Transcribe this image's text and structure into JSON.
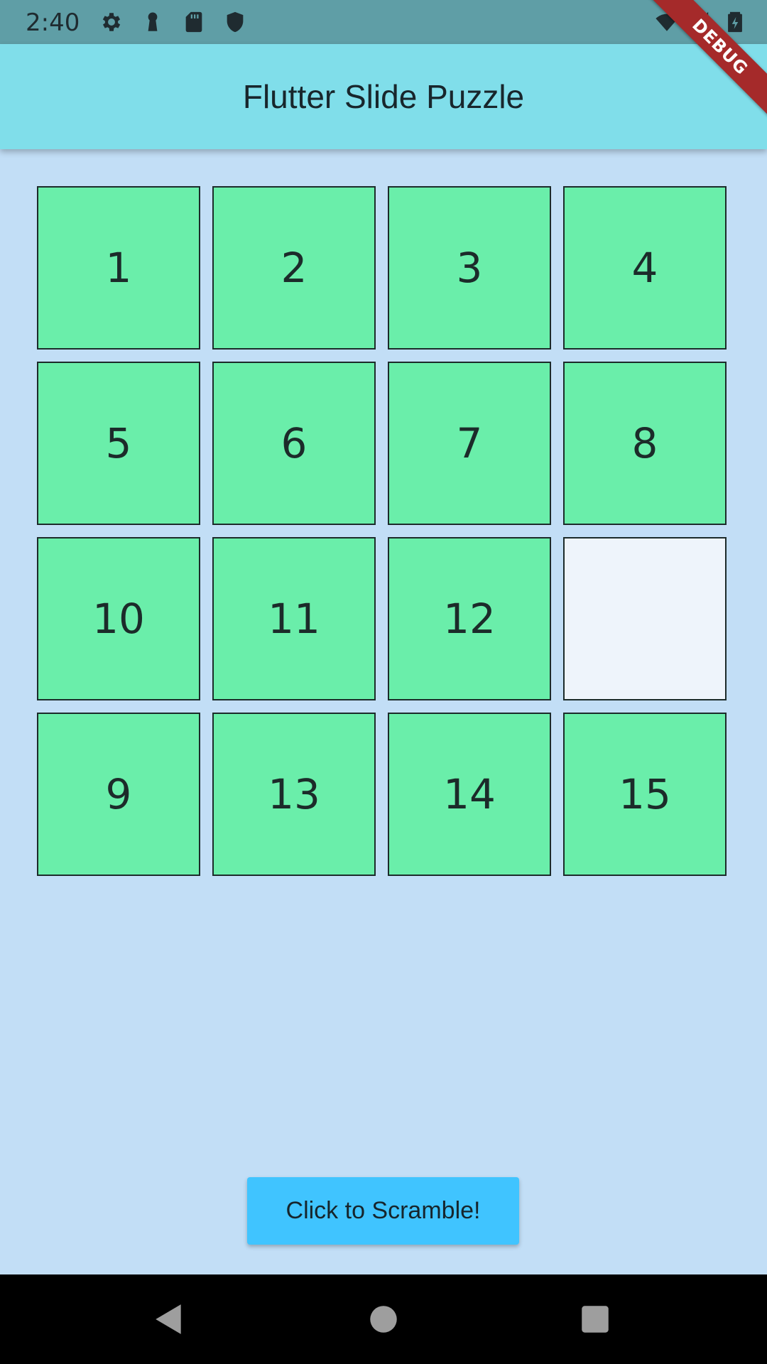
{
  "status_bar": {
    "time": "2:40",
    "icons": [
      "gear-icon",
      "keyhole-icon",
      "sd-card-icon",
      "shield-icon",
      "wifi-icon",
      "signal-icon",
      "battery-icon"
    ]
  },
  "app_bar": {
    "title": "Flutter Slide Puzzle"
  },
  "debug_banner": {
    "label": "DEBUG"
  },
  "colors": {
    "background": "#c2def6",
    "app_bar": "#80deea",
    "tile": "#6aeeaa",
    "empty_tile": "#eef4fb",
    "button": "#40c4ff",
    "debug_banner": "#a52a2a"
  },
  "puzzle": {
    "rows": [
      [
        "1",
        "2",
        "3",
        "4"
      ],
      [
        "5",
        "6",
        "7",
        "8"
      ],
      [
        "10",
        "11",
        "12",
        ""
      ],
      [
        "9",
        "13",
        "14",
        "15"
      ]
    ]
  },
  "scramble_button": {
    "label": "Click to Scramble!"
  },
  "nav_bar": {
    "buttons": [
      "back-icon",
      "home-icon",
      "recents-icon"
    ]
  }
}
